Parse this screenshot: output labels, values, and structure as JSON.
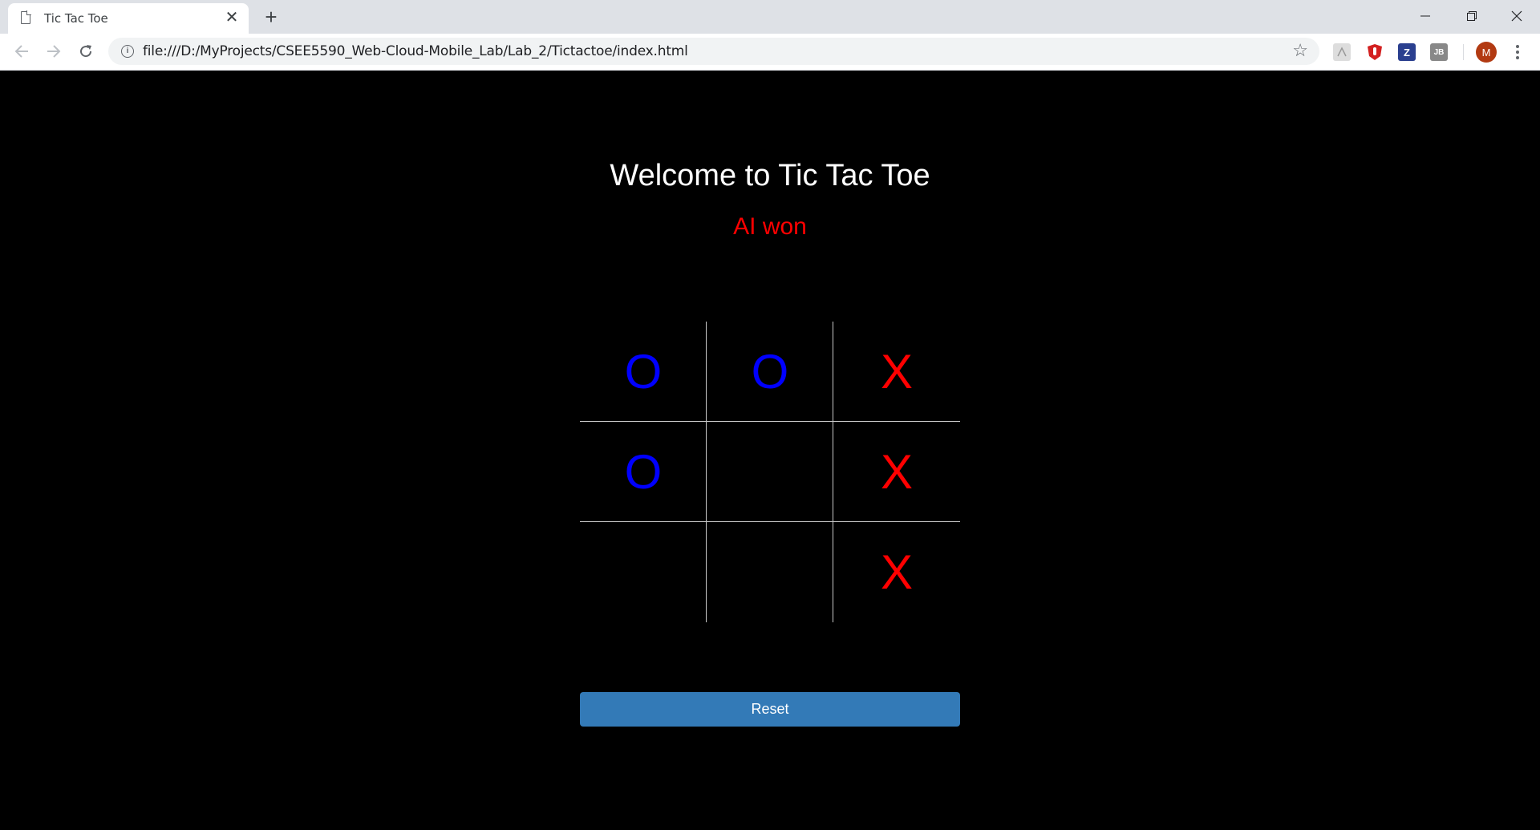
{
  "browser": {
    "tab_title": "Tic Tac Toe",
    "tab_close": "✕",
    "new_tab": "+",
    "url": "file:///D:/MyProjects/CSEE5590_Web-Cloud-Mobile_Lab/Lab_2/Tictactoe/index.html",
    "profile_initial": "M",
    "extensions": [
      "acrobat-icon",
      "ublock-icon",
      "zotero-icon",
      "jetbrains-icon"
    ],
    "extension_labels": [
      "",
      "",
      "Z",
      "JB"
    ]
  },
  "game": {
    "title": "Welcome to Tic Tac Toe",
    "status": "AI won",
    "status_color": "#ff0000",
    "board": [
      [
        "O",
        "O",
        "X"
      ],
      [
        "O",
        "",
        "X"
      ],
      [
        "",
        "",
        "X"
      ]
    ],
    "o_color": "#0000ff",
    "x_color": "#ff0000",
    "reset_label": "Reset",
    "reset_color": "#337ab7"
  }
}
